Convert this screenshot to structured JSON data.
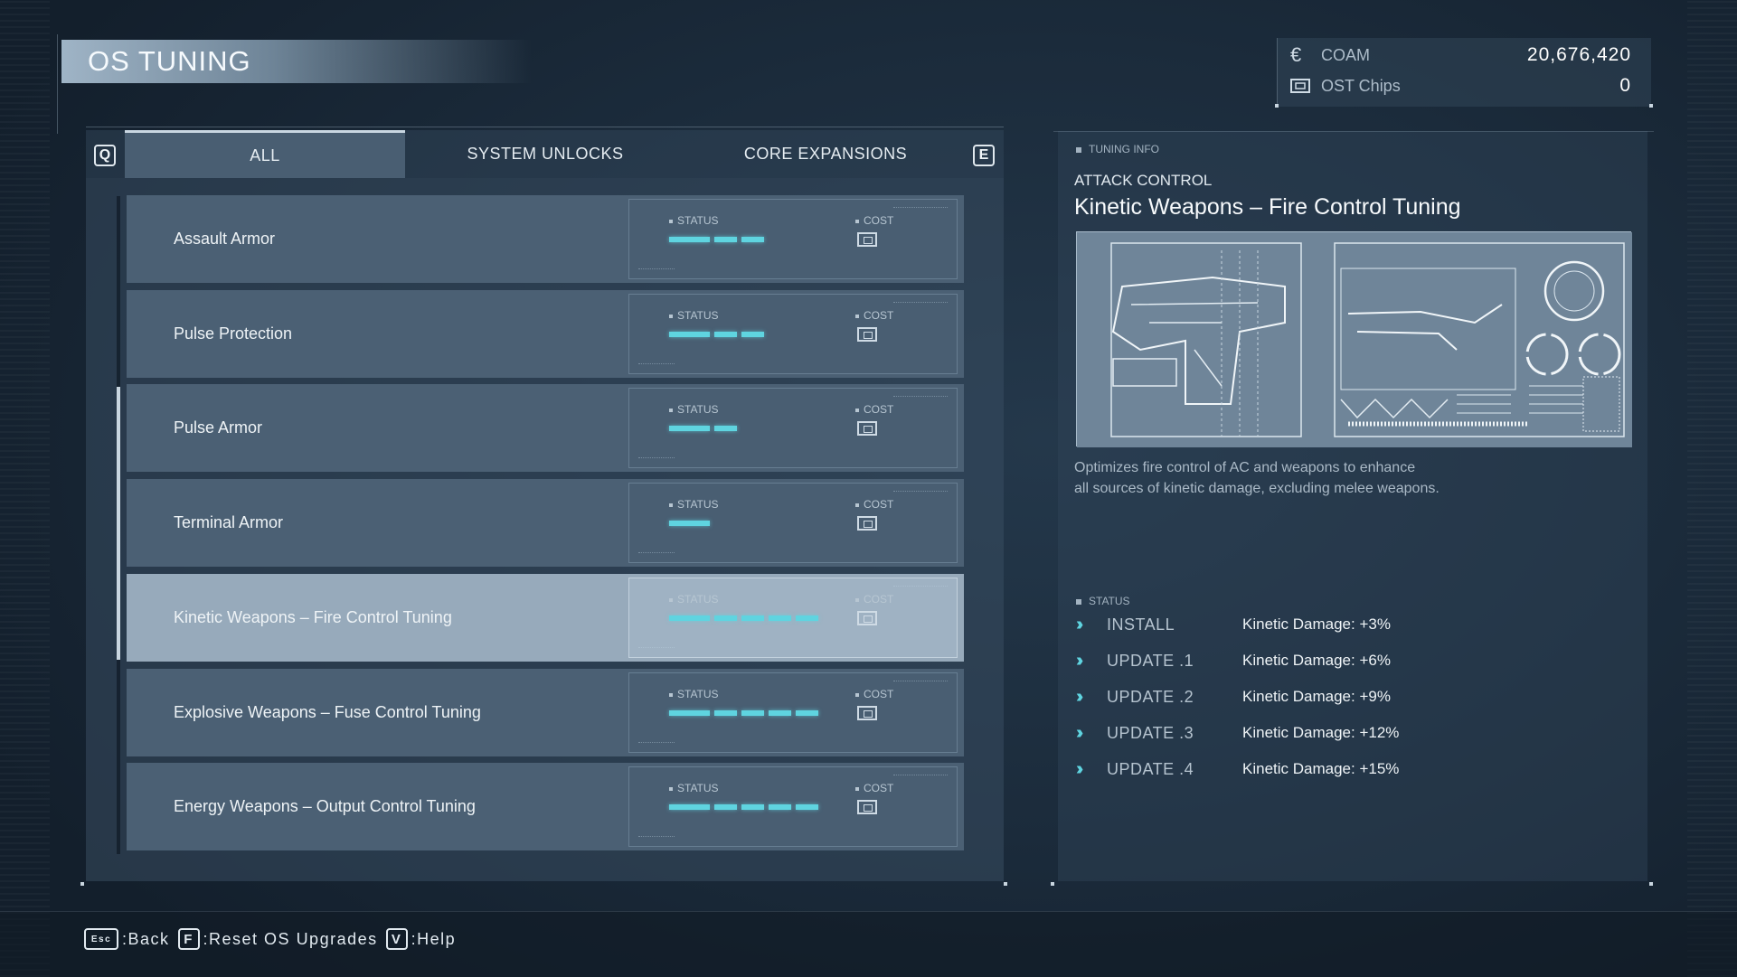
{
  "screen": {
    "title": "OS TUNING"
  },
  "currency": {
    "coam_label": "COAM",
    "coam_value": "20,676,420",
    "ost_label": "OST Chips",
    "ost_value": "0"
  },
  "tabs": {
    "prev_key": "Q",
    "next_key": "E",
    "items": [
      {
        "label": "ALL",
        "active": true
      },
      {
        "label": "SYSTEM UNLOCKS",
        "active": false
      },
      {
        "label": "CORE EXPANSIONS",
        "active": false
      }
    ]
  },
  "list": {
    "status_label": "STATUS",
    "cost_label": "COST",
    "items": [
      {
        "label": "Assault Armor",
        "status_level": 3,
        "status_max": 3,
        "selected": false
      },
      {
        "label": "Pulse Protection",
        "status_level": 3,
        "status_max": 3,
        "selected": false
      },
      {
        "label": "Pulse Armor",
        "status_level": 2,
        "status_max": 2,
        "selected": false
      },
      {
        "label": "Terminal Armor",
        "status_level": 1,
        "status_max": 1,
        "selected": false
      },
      {
        "label": "Kinetic Weapons – Fire Control Tuning",
        "status_level": 5,
        "status_max": 5,
        "selected": true
      },
      {
        "label": "Explosive Weapons – Fuse Control Tuning",
        "status_level": 5,
        "status_max": 5,
        "selected": false
      },
      {
        "label": "Energy Weapons – Output Control Tuning",
        "status_level": 5,
        "status_max": 5,
        "selected": false
      }
    ]
  },
  "info": {
    "section_label": "TUNING INFO",
    "category": "ATTACK CONTROL",
    "name": "Kinetic Weapons – Fire Control Tuning",
    "description_lines": [
      "Optimizes fire control of AC and weapons to enhance",
      "all sources of kinetic damage, excluding melee weapons."
    ],
    "status_label": "STATUS",
    "levels": [
      {
        "level": "INSTALL",
        "effect": "Kinetic Damage: +3%"
      },
      {
        "level": "UPDATE .1",
        "effect": "Kinetic Damage: +6%"
      },
      {
        "level": "UPDATE .2",
        "effect": "Kinetic Damage: +9%"
      },
      {
        "level": "UPDATE .3",
        "effect": "Kinetic Damage: +12%"
      },
      {
        "level": "UPDATE .4",
        "effect": "Kinetic Damage: +15%"
      }
    ]
  },
  "footer": {
    "hints": [
      {
        "key": "Esc",
        "label": ":Back"
      },
      {
        "key": "F",
        "label": ":Reset OS Upgrades"
      },
      {
        "key": "V",
        "label": ":Help"
      }
    ]
  },
  "colors": {
    "accent_cyan": "#5fd4e0",
    "row_bg": "#4b6074",
    "row_selected_bg": "#97aabb",
    "title_text": "#f6fafd"
  },
  "icons": {
    "coam": "coam-currency-icon",
    "ost": "ost-chip-icon",
    "cost": "chip-icon",
    "level": "double-chevron-icon"
  }
}
